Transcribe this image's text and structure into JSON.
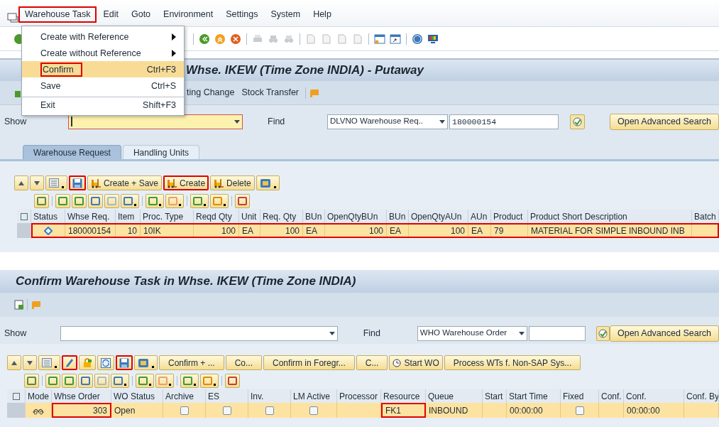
{
  "top_window": {
    "menu_bar": [
      {
        "label": "Warehouse Task",
        "highlighted": true
      },
      {
        "label": "Edit",
        "highlighted": false
      },
      {
        "label": "Goto",
        "highlighted": false
      },
      {
        "label": "Environment",
        "highlighted": false
      },
      {
        "label": "Settings",
        "highlighted": false
      },
      {
        "label": "System",
        "highlighted": false
      },
      {
        "label": "Help",
        "highlighted": false
      }
    ],
    "open_menu": [
      {
        "label": "Create with Reference",
        "submenu": true,
        "selected": false,
        "highlighted": false,
        "separator_before": false
      },
      {
        "label": "Create without Reference",
        "submenu": true,
        "selected": false,
        "highlighted": false,
        "separator_before": false
      },
      {
        "label": "Confirm",
        "shortcut": "Ctrl+F3",
        "submenu": false,
        "selected": true,
        "highlighted": true,
        "separator_before": false
      },
      {
        "label": "Save",
        "shortcut": "Ctrl+S",
        "submenu": false,
        "selected": false,
        "highlighted": false,
        "separator_before": false
      },
      {
        "label": "Exit",
        "shortcut": "Shift+F3",
        "submenu": false,
        "selected": false,
        "highlighted": false,
        "separator_before": true
      }
    ],
    "title": "Whse. IKEW (Time Zone INDIA) - Putaway",
    "app_toolbar": [
      "ting Change",
      "Stock Transfer"
    ],
    "show": {
      "label": "Show",
      "focused": true
    },
    "find": {
      "label": "Find",
      "option": "DLVNO Warehouse Req..",
      "value": "180000154"
    },
    "advanced_search": "Open Advanced Search",
    "tabs": [
      {
        "label": "Warehouse Request",
        "selected": true
      },
      {
        "label": "Handling Units",
        "selected": false
      }
    ],
    "buttons": [
      {
        "kind": "icon",
        "highlighted": false
      },
      {
        "kind": "icon",
        "highlighted": false
      },
      {
        "kind": "icon",
        "highlighted": false
      },
      {
        "kind": "icon",
        "highlighted": true
      },
      {
        "kind": "text",
        "label": "Create + Save",
        "highlighted": false
      },
      {
        "kind": "text",
        "label": "Create",
        "highlighted": true
      },
      {
        "kind": "text",
        "label": "Delete",
        "highlighted": false
      },
      {
        "kind": "icon",
        "highlighted": false
      }
    ],
    "table": {
      "columns": [
        "Status",
        "Whse Req.",
        "Item",
        "Proc. Type",
        "Reqd Qty",
        "Unit",
        "Req. Qty",
        "BUn",
        "OpenQtyBUn",
        "BUn",
        "OpenQtyAUn",
        "AUn",
        "Product",
        "Product Short Description",
        "Batch"
      ],
      "rows": [
        {
          "selected": true,
          "highlighted": true,
          "cells": [
            {
              "kind": "icon"
            },
            {
              "kind": "text",
              "text": "180000154"
            },
            {
              "kind": "number",
              "text": "10"
            },
            {
              "kind": "text",
              "text": "10IK"
            },
            {
              "kind": "number",
              "text": "100"
            },
            {
              "kind": "text",
              "text": "EA"
            },
            {
              "kind": "number",
              "text": "100"
            },
            {
              "kind": "text",
              "text": "EA"
            },
            {
              "kind": "number",
              "text": "100"
            },
            {
              "kind": "text",
              "text": "EA"
            },
            {
              "kind": "number",
              "text": "100"
            },
            {
              "kind": "text",
              "text": "EA"
            },
            {
              "kind": "text",
              "text": "79"
            },
            {
              "kind": "text",
              "text": "MATERIAL FOR SIMPLE INBOUND INB"
            },
            {
              "kind": "empty"
            }
          ]
        }
      ]
    }
  },
  "bottom_window": {
    "title": "Confirm Warehouse Task in Whse. IKEW (Time Zone INDIA)",
    "show": {
      "label": "Show",
      "focused": false
    },
    "find": {
      "label": "Find",
      "option": "WHO Warehouse Order"
    },
    "advanced_search": "Open Advanced Search",
    "buttons": [
      {
        "kind": "icon",
        "highlighted": false
      },
      {
        "kind": "icon",
        "highlighted": false
      },
      {
        "kind": "icon",
        "highlighted": false
      },
      {
        "kind": "icon",
        "highlighted": true
      },
      {
        "kind": "icon",
        "highlighted": false
      },
      {
        "kind": "icon",
        "highlighted": false
      },
      {
        "kind": "icon",
        "highlighted": true
      },
      {
        "kind": "icon",
        "highlighted": false
      },
      {
        "kind": "text",
        "label": "Confirm + ...",
        "highlighted": false
      },
      {
        "kind": "text",
        "label": "Co...",
        "highlighted": false
      },
      {
        "kind": "text",
        "label": "Confirm in Foregr...",
        "highlighted": false
      },
      {
        "kind": "text",
        "label": "C...",
        "highlighted": false
      },
      {
        "kind": "clock",
        "label": "Start WO",
        "highlighted": false
      },
      {
        "kind": "text",
        "label": "Process WTs f. Non-SAP Sys...",
        "highlighted": false
      }
    ],
    "table": {
      "columns": [
        "Mode",
        "Whse Order",
        "WO Status",
        "Archive",
        "ES",
        "Inv.",
        "LM Active",
        "Processor",
        "Resource",
        "Queue",
        "Start",
        "Start Time",
        "Fixed",
        "Conf.",
        "Conf.",
        "Conf. By"
      ],
      "rows": [
        {
          "selected": true,
          "cells": [
            {
              "kind": "icon",
              "highlighted": false
            },
            {
              "kind": "number",
              "text": "303",
              "highlighted": true
            },
            {
              "kind": "text",
              "text": "Open",
              "highlighted": false
            },
            {
              "kind": "checkbox",
              "checked": false,
              "highlighted": false
            },
            {
              "kind": "checkbox",
              "checked": false,
              "highlighted": false
            },
            {
              "kind": "checkbox",
              "checked": false,
              "highlighted": false
            },
            {
              "kind": "checkbox",
              "checked": false,
              "highlighted": false
            },
            {
              "kind": "empty",
              "highlighted": false
            },
            {
              "kind": "text",
              "text": "FK1",
              "highlighted": true
            },
            {
              "kind": "text",
              "text": "INBOUND",
              "highlighted": false
            },
            {
              "kind": "empty",
              "highlighted": false
            },
            {
              "kind": "text",
              "text": "00:00:00",
              "highlighted": false
            },
            {
              "kind": "checkbox",
              "checked": false,
              "highlighted": false
            },
            {
              "kind": "empty",
              "highlighted": false
            },
            {
              "kind": "text",
              "text": "00:00:00",
              "highlighted": false
            },
            {
              "kind": "empty",
              "highlighted": false
            }
          ]
        }
      ]
    }
  }
}
